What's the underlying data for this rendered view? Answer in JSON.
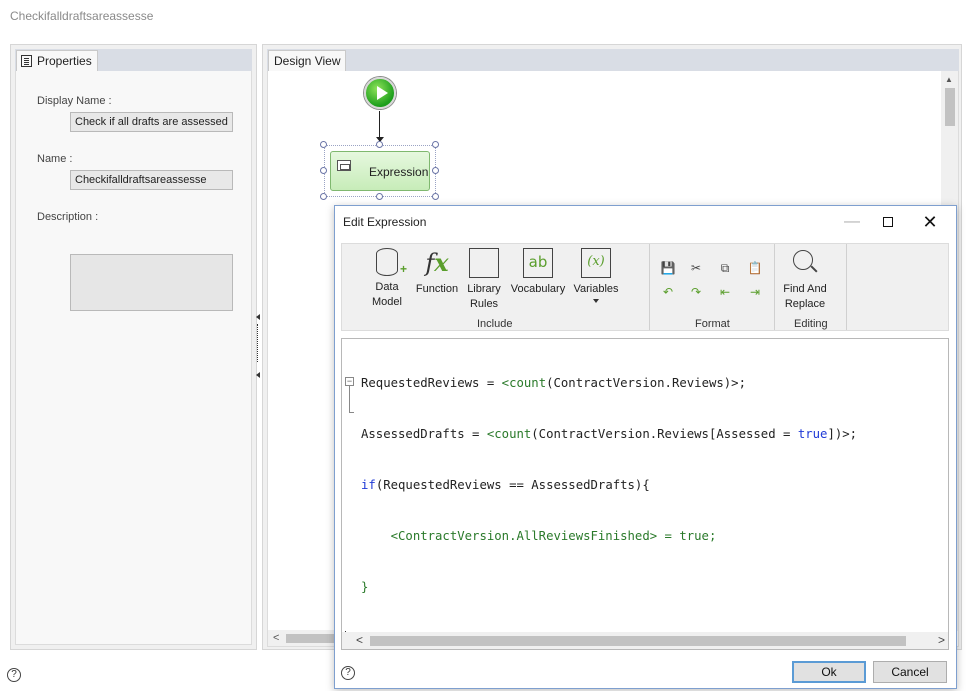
{
  "window": {
    "title": "Checkifalldraftsareassesse"
  },
  "properties": {
    "tab_label": "Properties",
    "display_name_label": "Display Name :",
    "display_name_value": "Check if all drafts are assessed",
    "name_label": "Name :",
    "name_value": "Checkifalldraftsareassesse",
    "description_label": "Description :",
    "description_value": ""
  },
  "design": {
    "tab_label": "Design View",
    "expression_node_label": "Expression"
  },
  "dialog": {
    "title": "Edit Expression",
    "ribbon": {
      "include": {
        "label": "Include",
        "buttons": [
          {
            "line1": "Data",
            "line2": "Model",
            "icon": "database-add-icon"
          },
          {
            "line1": "Function",
            "line2": "",
            "icon": "function-fx-icon"
          },
          {
            "line1": "Library",
            "line2": "Rules",
            "icon": "library-rules-icon"
          },
          {
            "line1": "Vocabulary",
            "line2": "",
            "icon": "vocabulary-icon"
          },
          {
            "line1": "Variables",
            "line2": "",
            "icon": "variables-icon"
          }
        ]
      },
      "format": {
        "label": "Format",
        "icons": [
          "save-icon",
          "cut-icon",
          "copy-icon",
          "paste-icon",
          "undo-icon",
          "redo-icon",
          "outdent-icon",
          "indent-icon"
        ]
      },
      "editing": {
        "label": "Editing",
        "find_line1": "Find And",
        "find_line2": "Replace"
      }
    },
    "code_lines": [
      "RequestedReviews = <count(ContractVersion.Reviews)>;",
      "AssessedDrafts = <count(ContractVersion.Reviews[Assessed = true])>;",
      "if(RequestedReviews == AssessedDrafts){",
      "    <ContractVersion.AllReviewsFinished> = true;",
      "}"
    ],
    "ok_label": "Ok",
    "cancel_label": "Cancel"
  },
  "help_glyph": "?"
}
